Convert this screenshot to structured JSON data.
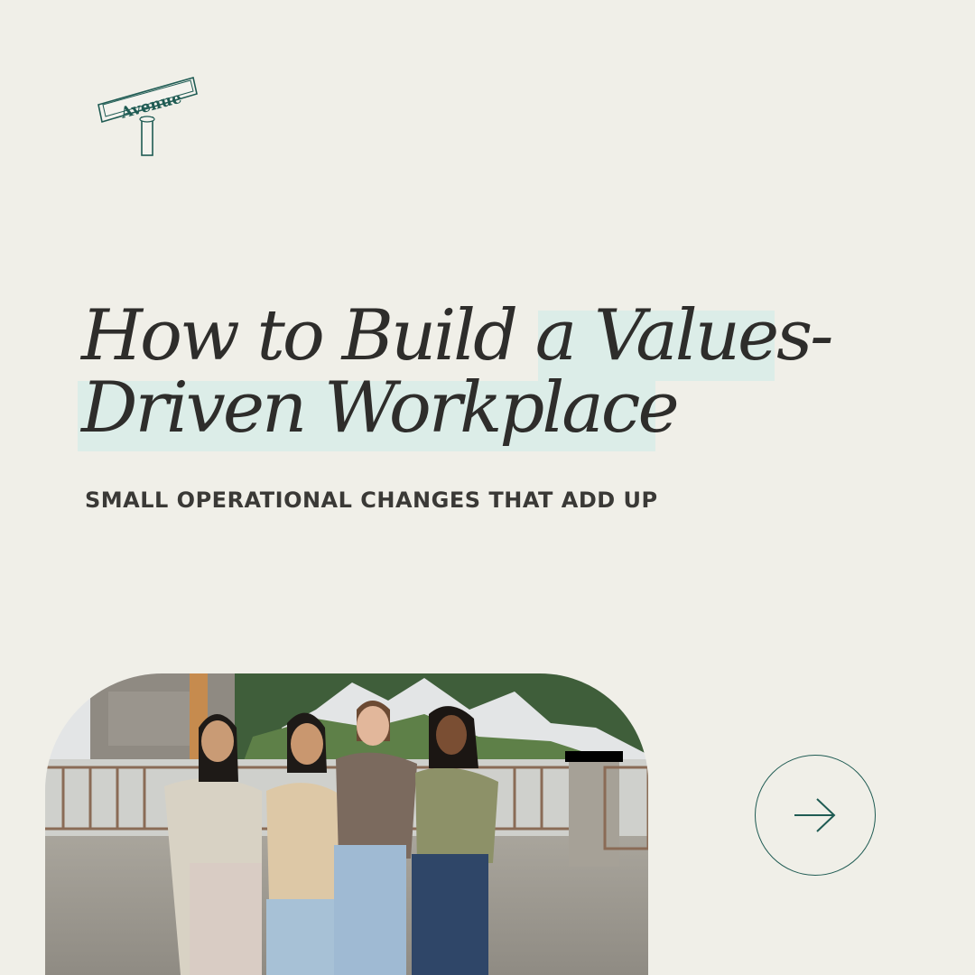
{
  "logo": {
    "text": "Avenue"
  },
  "headline": {
    "line1_plain": "How to Build a ",
    "line1_highlight": "Values-",
    "line2_highlight": "Driven Workplace"
  },
  "subtitle": "SMALL OPERATIONAL CHANGES THAT ADD UP",
  "photo": {
    "alt": "Four people smiling together outdoors"
  },
  "next_button": {
    "icon": "arrow-right-icon"
  },
  "colors": {
    "background": "#f0efe8",
    "highlight": "#dcede8",
    "accent": "#1f5b53",
    "text": "#2e2d2b"
  }
}
